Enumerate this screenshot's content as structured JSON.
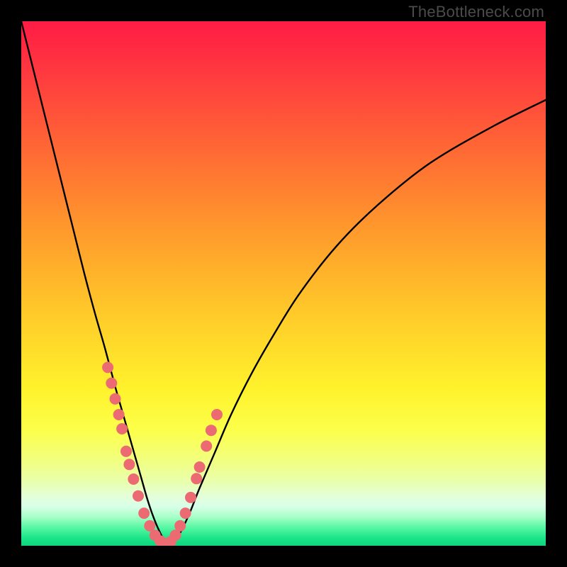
{
  "watermark": "TheBottleneck.com",
  "colors": {
    "frame": "#000000",
    "curve_stroke": "#000000",
    "marker_fill": "#ec6b72",
    "gradient_stops": [
      {
        "offset": 0.0,
        "color": "#ff1b45"
      },
      {
        "offset": 0.1,
        "color": "#ff3a3f"
      },
      {
        "offset": 0.25,
        "color": "#ff6a34"
      },
      {
        "offset": 0.4,
        "color": "#ff9a2c"
      },
      {
        "offset": 0.55,
        "color": "#ffc829"
      },
      {
        "offset": 0.7,
        "color": "#fff22c"
      },
      {
        "offset": 0.78,
        "color": "#fcff4a"
      },
      {
        "offset": 0.84,
        "color": "#f1ff82"
      },
      {
        "offset": 0.88,
        "color": "#e8ffb0"
      },
      {
        "offset": 0.905,
        "color": "#e4ffd8"
      },
      {
        "offset": 0.925,
        "color": "#d8ffe8"
      },
      {
        "offset": 0.945,
        "color": "#a8ffc8"
      },
      {
        "offset": 0.965,
        "color": "#58f7a4"
      },
      {
        "offset": 0.985,
        "color": "#1be589"
      },
      {
        "offset": 1.0,
        "color": "#0fd47e"
      }
    ]
  },
  "chart_data": {
    "type": "line",
    "title": "",
    "xlabel": "",
    "ylabel": "",
    "xlim": [
      0,
      100
    ],
    "ylim": [
      0,
      100
    ],
    "series": [
      {
        "name": "bottleneck-curve",
        "x": [
          0,
          2,
          4,
          6,
          8,
          10,
          12,
          14,
          16,
          18,
          19,
          20,
          21,
          22,
          23,
          24,
          25,
          26,
          27,
          28,
          30,
          32,
          34,
          37,
          40,
          44,
          48,
          53,
          60,
          68,
          78,
          90,
          100
        ],
        "y": [
          100,
          92,
          84,
          76,
          68,
          60,
          52,
          44.5,
          37.5,
          30,
          26.5,
          23,
          19.5,
          16,
          12.5,
          9,
          6,
          3.5,
          1.5,
          0.4,
          2,
          6,
          11,
          18,
          25,
          33,
          40,
          48,
          57,
          65,
          73,
          80,
          85
        ]
      }
    ],
    "markers": [
      {
        "x": 16.5,
        "y": 34
      },
      {
        "x": 17.2,
        "y": 31
      },
      {
        "x": 17.9,
        "y": 28
      },
      {
        "x": 18.6,
        "y": 25
      },
      {
        "x": 19.2,
        "y": 22.3
      },
      {
        "x": 20.0,
        "y": 18
      },
      {
        "x": 20.6,
        "y": 15.5
      },
      {
        "x": 21.4,
        "y": 12.7
      },
      {
        "x": 22.3,
        "y": 9.5
      },
      {
        "x": 23.4,
        "y": 6.2
      },
      {
        "x": 24.5,
        "y": 3.8
      },
      {
        "x": 25.5,
        "y": 2.0
      },
      {
        "x": 26.5,
        "y": 0.9
      },
      {
        "x": 27.5,
        "y": 0.4
      },
      {
        "x": 28.5,
        "y": 0.8
      },
      {
        "x": 29.4,
        "y": 2.0
      },
      {
        "x": 30.3,
        "y": 3.8
      },
      {
        "x": 31.3,
        "y": 6.2
      },
      {
        "x": 32.3,
        "y": 9.2
      },
      {
        "x": 33.4,
        "y": 12.8
      },
      {
        "x": 34.0,
        "y": 15
      },
      {
        "x": 35.3,
        "y": 19
      },
      {
        "x": 36.2,
        "y": 22
      },
      {
        "x": 37.3,
        "y": 25
      }
    ]
  }
}
